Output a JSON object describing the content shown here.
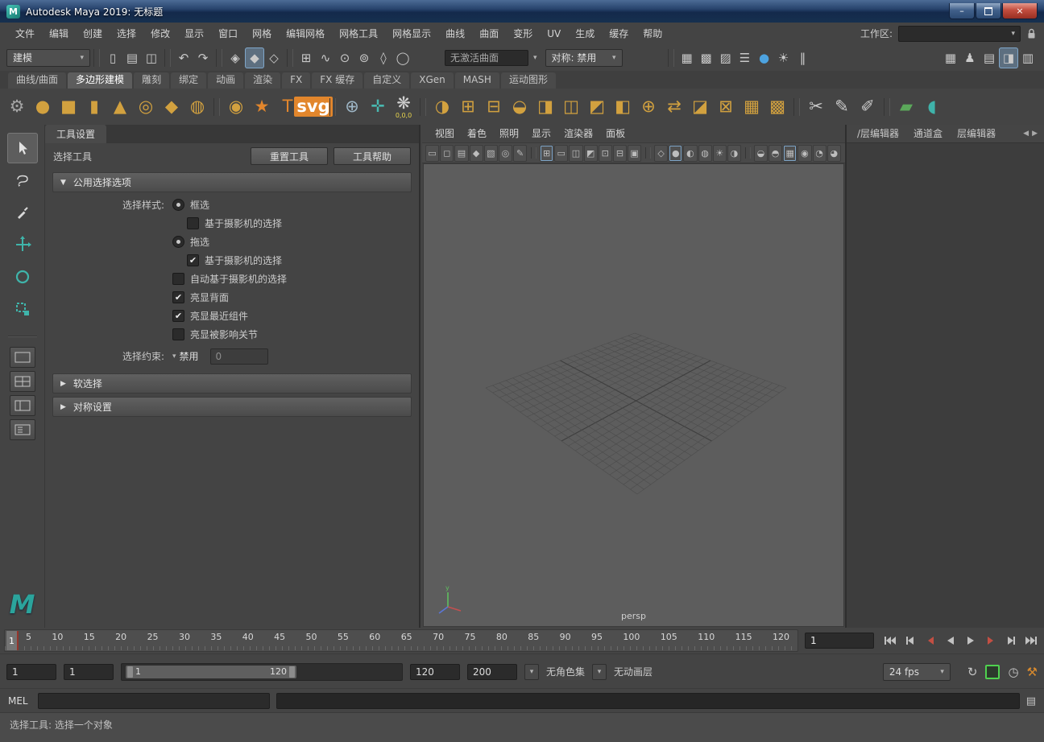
{
  "titlebar": {
    "title": "Autodesk Maya 2019: 无标题"
  },
  "menubar": {
    "items": [
      "文件",
      "编辑",
      "创建",
      "选择",
      "修改",
      "显示",
      "窗口",
      "网格",
      "编辑网格",
      "网格工具",
      "网格显示",
      "曲线",
      "曲面",
      "变形",
      "UV",
      "生成",
      "缓存",
      "帮助"
    ],
    "workspace_label": "工作区:",
    "workspace_value": ""
  },
  "toolbar": {
    "mode": "建模",
    "no_live_surface": "无激活曲面",
    "symmetry": "对称: 禁用",
    "file_icons": [
      {
        "name": "new-scene-icon",
        "glyph": "▯"
      },
      {
        "name": "open-scene-icon",
        "glyph": "▤"
      },
      {
        "name": "save-scene-icon",
        "glyph": "◫"
      }
    ],
    "history_icons": [
      {
        "name": "undo-icon",
        "glyph": "↶"
      },
      {
        "name": "redo-icon",
        "glyph": "↷"
      }
    ],
    "mode_icons": [
      {
        "name": "hierarchy-mode-icon",
        "glyph": "◈"
      },
      {
        "name": "object-mode-icon",
        "glyph": "◆",
        "active": true
      },
      {
        "name": "component-mode-icon",
        "glyph": "◇"
      }
    ],
    "snap_icons": [
      {
        "name": "snap-to-grid-icon",
        "glyph": "⊞"
      },
      {
        "name": "snap-to-curve-icon",
        "glyph": "∿"
      },
      {
        "name": "snap-to-point-icon",
        "glyph": "⊙"
      },
      {
        "name": "snap-to-projected-center-icon",
        "glyph": "⊚"
      },
      {
        "name": "snap-to-view-plane-icon",
        "glyph": "◊"
      },
      {
        "name": "make-live-icon",
        "glyph": "◯"
      }
    ],
    "render_icons": [
      {
        "name": "render-view-icon",
        "glyph": "▦"
      },
      {
        "name": "render-current-frame-icon",
        "glyph": "▩"
      },
      {
        "name": "ipr-render-icon",
        "glyph": "▨"
      },
      {
        "name": "render-settings-icon",
        "glyph": "☰"
      },
      {
        "name": "hypershade-icon",
        "glyph": "●",
        "color": "#4da3e0"
      },
      {
        "name": "light-editor-icon",
        "glyph": "☀"
      },
      {
        "name": "pause-icon",
        "glyph": "‖"
      }
    ],
    "sidebar_icons": [
      {
        "name": "modeling-toolkit-icon",
        "glyph": "▦"
      },
      {
        "name": "humanik-icon",
        "glyph": "♟"
      },
      {
        "name": "attribute-editor-icon",
        "glyph": "▤"
      },
      {
        "name": "tool-settings-icon",
        "glyph": "◨",
        "active": true
      },
      {
        "name": "channel-box-icon",
        "glyph": "▥"
      }
    ]
  },
  "shelf": {
    "tabs": [
      {
        "label": "曲线/曲面"
      },
      {
        "label": "多边形建模",
        "active": true
      },
      {
        "label": "雕刻"
      },
      {
        "label": "绑定"
      },
      {
        "label": "动画"
      },
      {
        "label": "渲染"
      },
      {
        "label": "FX"
      },
      {
        "label": "FX 缓存"
      },
      {
        "label": "自定义"
      },
      {
        "label": "XGen"
      },
      {
        "label": "MASH"
      },
      {
        "label": "运动图形"
      }
    ],
    "icons": [
      {
        "name": "shelf-gear-icon",
        "glyph": "⚙",
        "color": "#a5a5a5"
      },
      {
        "name": "poly-sphere-icon",
        "glyph": "●",
        "color": "#d2a13f"
      },
      {
        "name": "poly-cube-icon",
        "glyph": "■",
        "color": "#d2a13f"
      },
      {
        "name": "poly-cylinder-icon",
        "glyph": "▮",
        "color": "#d2a13f"
      },
      {
        "name": "poly-cone-icon",
        "glyph": "▲",
        "color": "#d2a13f"
      },
      {
        "name": "poly-torus-icon",
        "glyph": "◎",
        "color": "#d2a13f"
      },
      {
        "name": "poly-plane-icon",
        "glyph": "◆",
        "color": "#d2a13f"
      },
      {
        "name": "poly-disc-icon",
        "glyph": "◍",
        "color": "#d2a13f"
      },
      {
        "sep": true
      },
      {
        "name": "platonic-solid-icon",
        "glyph": "◉",
        "color": "#d2a13f"
      },
      {
        "name": "sweep-mesh-icon",
        "glyph": "★",
        "color": "#e2862c"
      },
      {
        "name": "type-tool-icon",
        "glyph": "T",
        "color": "#e2862c"
      },
      {
        "name": "svg-tool-icon",
        "glyph": "svg",
        "badge": true
      },
      {
        "sep": true
      },
      {
        "name": "measure-distance-icon",
        "glyph": "⊕",
        "color": "#9fb7c7"
      },
      {
        "name": "locator-axis-icon",
        "glyph": "✛",
        "color": "#49b8b0"
      },
      {
        "name": "snowflake-locator-icon",
        "glyph": "❋",
        "color": "#cfcfcf",
        "label": "0,0,0",
        "label_color": "#e8d44d"
      },
      {
        "sep": true
      },
      {
        "name": "boolean-icon",
        "glyph": "◑",
        "color": "#d2a13f"
      },
      {
        "name": "combine-icon",
        "glyph": "⊞",
        "color": "#d2a13f"
      },
      {
        "name": "separate-icon",
        "glyph": "⊟",
        "color": "#d2a13f"
      },
      {
        "name": "smooth-icon",
        "glyph": "◒",
        "color": "#d2a13f"
      },
      {
        "name": "extrude-icon",
        "glyph": "◨",
        "color": "#d2a13f"
      },
      {
        "name": "bridge-icon",
        "glyph": "◫",
        "color": "#d2a13f"
      },
      {
        "name": "bevel-icon",
        "glyph": "◩",
        "color": "#d2a13f"
      },
      {
        "name": "mirror-icon",
        "glyph": "◧",
        "color": "#d2a13f"
      },
      {
        "name": "merge-icon",
        "glyph": "⊕",
        "color": "#d2a13f"
      },
      {
        "name": "transfer-attributes-icon",
        "glyph": "⇄",
        "color": "#d2a13f"
      },
      {
        "name": "wedge-icon",
        "glyph": "◪",
        "color": "#d2a13f"
      },
      {
        "name": "poke-icon",
        "glyph": "⊠",
        "color": "#d2a13f"
      },
      {
        "name": "remesh-icon",
        "glyph": "▦",
        "color": "#d2a13f"
      },
      {
        "name": "retopologize-icon",
        "glyph": "▩",
        "color": "#d2a13f"
      },
      {
        "sep": true
      },
      {
        "name": "multi-cut-icon",
        "glyph": "✂",
        "color": "#c9c9c9"
      },
      {
        "name": "connect-tool-icon",
        "glyph": "✎",
        "color": "#c9c9c9"
      },
      {
        "name": "crease-tool-icon",
        "glyph": "✐",
        "color": "#c9c9c9"
      },
      {
        "sep": true
      },
      {
        "name": "paint-transfer-icon",
        "glyph": "▰",
        "color": "#5ba85a"
      },
      {
        "name": "sculpt-tool-icon",
        "glyph": "◖",
        "color": "#3fb3aa"
      }
    ]
  },
  "tool_settings": {
    "title": "工具设置",
    "tool_label": "选择工具",
    "reset": "重置工具",
    "help": "工具帮助",
    "common_header": "公用选择选项",
    "style_label": "选择样式:",
    "opt_marquee": "框选",
    "opt_camera1": "基于摄影机的选择",
    "opt_drag": "拖选",
    "opt_camera2": "基于摄影机的选择",
    "opt_auto_camera": "自动基于摄影机的选择",
    "opt_backface": "亮显背面",
    "opt_nearest": "亮显最近组件",
    "opt_joints": "亮显被影响关节",
    "constraint_label": "选择约束:",
    "constraint_value": "禁用",
    "constraint_num": "0",
    "soft_header": "软选择",
    "sym_header": "对称设置"
  },
  "viewport": {
    "menus": [
      "视图",
      "着色",
      "照明",
      "显示",
      "渲染器",
      "面板"
    ],
    "camera": "persp",
    "icons": [
      {
        "name": "select-camera-icon",
        "glyph": "▭"
      },
      {
        "name": "camera-lock-icon",
        "glyph": "◻"
      },
      {
        "name": "camera-attributes-icon",
        "glyph": "▤"
      },
      {
        "name": "bookmark-icon",
        "glyph": "◆"
      },
      {
        "name": "image-plane-icon",
        "glyph": "▧"
      },
      {
        "name": "pan-zoom-icon",
        "glyph": "◎"
      },
      {
        "name": "grease-pencil-icon",
        "glyph": "✎"
      },
      {
        "sep": true
      },
      {
        "name": "grid-icon",
        "glyph": "⊞",
        "active": true
      },
      {
        "name": "film-gate-icon",
        "glyph": "▭"
      },
      {
        "name": "resolution-gate-icon",
        "glyph": "◫"
      },
      {
        "name": "gate-mask-icon",
        "glyph": "◩"
      },
      {
        "name": "field-chart-icon",
        "glyph": "⊡"
      },
      {
        "name": "safe-action-icon",
        "glyph": "⊟"
      },
      {
        "name": "safe-title-icon",
        "glyph": "▣"
      },
      {
        "sep": true
      },
      {
        "name": "wireframe-icon",
        "glyph": "◇"
      },
      {
        "name": "shaded-icon",
        "glyph": "●",
        "active": true
      },
      {
        "name": "textured-icon",
        "glyph": "◐"
      },
      {
        "name": "default-material-icon",
        "glyph": "◍"
      },
      {
        "name": "lighting-icon",
        "glyph": "☀"
      },
      {
        "name": "shadows-icon",
        "glyph": "◑"
      },
      {
        "sep": true
      },
      {
        "name": "ambient-occlusion-icon",
        "glyph": "◒"
      },
      {
        "name": "motion-blur-icon",
        "glyph": "◓"
      },
      {
        "name": "multisample-icon",
        "glyph": "▦",
        "active": true
      },
      {
        "name": "depth-of-field-icon",
        "glyph": "◉"
      },
      {
        "name": "isolate-select-icon",
        "glyph": "◔"
      },
      {
        "name": "xray-icon",
        "glyph": "◕"
      }
    ]
  },
  "right_panel": {
    "tabs": [
      "/层编辑器",
      "通道盒",
      "层编辑器"
    ]
  },
  "timeline": {
    "current": "1",
    "ticks": [
      "5",
      "10",
      "15",
      "20",
      "25",
      "30",
      "35",
      "40",
      "45",
      "50",
      "55",
      "60",
      "65",
      "70",
      "75",
      "80",
      "85",
      "90",
      "95",
      "100",
      "105",
      "110",
      "115",
      "120"
    ],
    "frame_field": "1"
  },
  "range": {
    "f1": "1",
    "f2": "1",
    "bar_start": "1",
    "bar_end": "120",
    "f3": "120",
    "f4": "200",
    "character_set": "无角色集",
    "anim_layer": "无动画层",
    "fps": "24 fps"
  },
  "mel": {
    "label": "MEL",
    "input": "",
    "output": ""
  },
  "help": {
    "text": "选择工具: 选择一个对象"
  }
}
